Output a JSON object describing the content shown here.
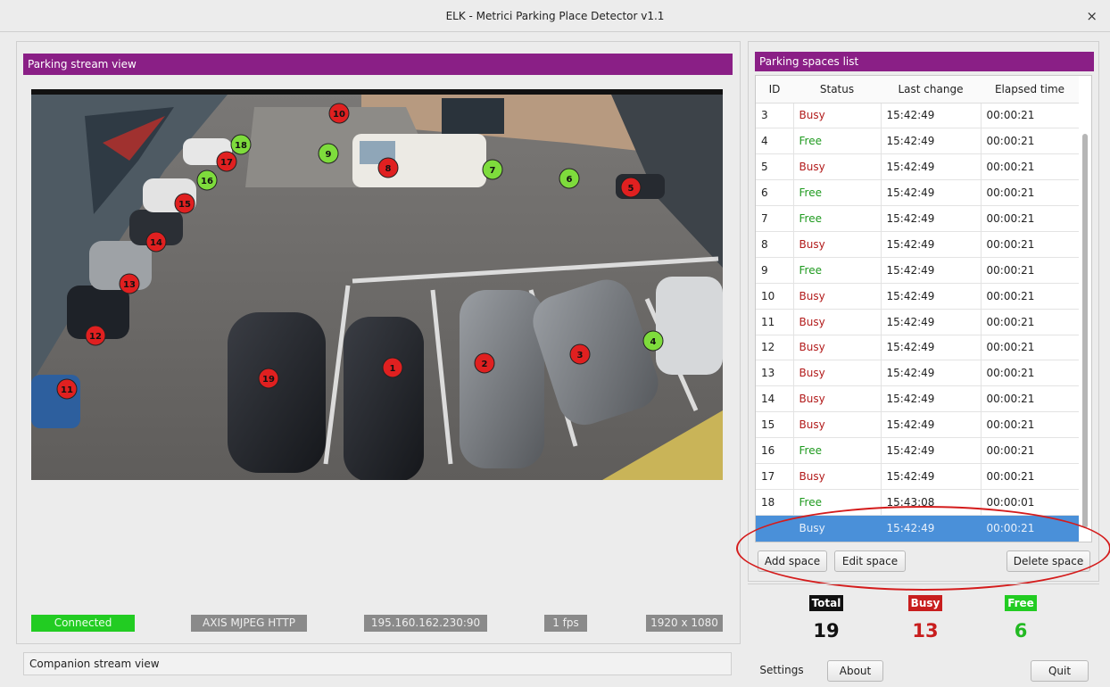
{
  "window": {
    "title": "ELK - Metrici Parking Place Detector v1.1",
    "close_glyph": "×"
  },
  "stream": {
    "header": "Parking stream view",
    "markers": [
      {
        "label": "1",
        "state": "busy"
      },
      {
        "label": "2",
        "state": "busy"
      },
      {
        "label": "3",
        "state": "busy"
      },
      {
        "label": "4",
        "state": "free"
      },
      {
        "label": "5",
        "state": "busy"
      },
      {
        "label": "6",
        "state": "free"
      },
      {
        "label": "7",
        "state": "free"
      },
      {
        "label": "8",
        "state": "busy"
      },
      {
        "label": "9",
        "state": "free"
      },
      {
        "label": "10",
        "state": "busy"
      },
      {
        "label": "11",
        "state": "busy"
      },
      {
        "label": "12",
        "state": "busy"
      },
      {
        "label": "13",
        "state": "busy"
      },
      {
        "label": "14",
        "state": "busy"
      },
      {
        "label": "15",
        "state": "busy"
      },
      {
        "label": "16",
        "state": "free"
      },
      {
        "label": "17",
        "state": "busy"
      },
      {
        "label": "18",
        "state": "free"
      },
      {
        "label": "19",
        "state": "busy"
      }
    ],
    "status": {
      "connection": "Connected",
      "protocol": "AXIS MJPEG HTTP",
      "address": "195.160.162.230:90",
      "fps": "1 fps",
      "resolution": "1920 x 1080"
    },
    "companion_label": "Companion stream view"
  },
  "spaces": {
    "header": "Parking spaces list",
    "columns": [
      "ID",
      "Status",
      "Last change",
      "Elapsed time"
    ],
    "rows": [
      {
        "id": "3",
        "status": "Busy",
        "last": "15:42:49",
        "elapsed": "00:00:21"
      },
      {
        "id": "4",
        "status": "Free",
        "last": "15:42:49",
        "elapsed": "00:00:21"
      },
      {
        "id": "5",
        "status": "Busy",
        "last": "15:42:49",
        "elapsed": "00:00:21"
      },
      {
        "id": "6",
        "status": "Free",
        "last": "15:42:49",
        "elapsed": "00:00:21"
      },
      {
        "id": "7",
        "status": "Free",
        "last": "15:42:49",
        "elapsed": "00:00:21"
      },
      {
        "id": "8",
        "status": "Busy",
        "last": "15:42:49",
        "elapsed": "00:00:21"
      },
      {
        "id": "9",
        "status": "Free",
        "last": "15:42:49",
        "elapsed": "00:00:21"
      },
      {
        "id": "10",
        "status": "Busy",
        "last": "15:42:49",
        "elapsed": "00:00:21"
      },
      {
        "id": "11",
        "status": "Busy",
        "last": "15:42:49",
        "elapsed": "00:00:21"
      },
      {
        "id": "12",
        "status": "Busy",
        "last": "15:42:49",
        "elapsed": "00:00:21"
      },
      {
        "id": "13",
        "status": "Busy",
        "last": "15:42:49",
        "elapsed": "00:00:21"
      },
      {
        "id": "14",
        "status": "Busy",
        "last": "15:42:49",
        "elapsed": "00:00:21"
      },
      {
        "id": "15",
        "status": "Busy",
        "last": "15:42:49",
        "elapsed": "00:00:21"
      },
      {
        "id": "16",
        "status": "Free",
        "last": "15:42:49",
        "elapsed": "00:00:21"
      },
      {
        "id": "17",
        "status": "Busy",
        "last": "15:42:49",
        "elapsed": "00:00:21"
      },
      {
        "id": "18",
        "status": "Free",
        "last": "15:43:08",
        "elapsed": "00:00:01"
      },
      {
        "id": "",
        "status": "Busy",
        "last": "15:42:49",
        "elapsed": "00:00:21",
        "selected": true
      }
    ],
    "buttons": {
      "add": "Add space",
      "edit": "Edit space",
      "delete": "Delete space"
    }
  },
  "summary": {
    "total_label": "Total",
    "total": "19",
    "busy_label": "Busy",
    "busy": "13",
    "free_label": "Free",
    "free": "6"
  },
  "footer": {
    "settings": "Settings",
    "about": "About",
    "quit": "Quit"
  },
  "colors": {
    "header_purple": "#8a1f86",
    "busy_red": "#b21a1a",
    "free_green": "#1f9a1f",
    "marker_busy": "#e02020",
    "marker_free": "#7edc3c",
    "connected_green": "#22cc22",
    "selection_blue": "#4a90d9"
  }
}
